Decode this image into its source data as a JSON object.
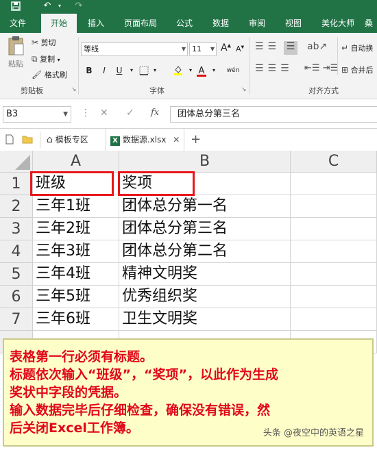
{
  "qat": {
    "save_icon": "save-icon",
    "undo_icon": "undo-icon",
    "redo_icon": "redo-icon"
  },
  "tabs": [
    {
      "label": "文件"
    },
    {
      "label": "开始"
    },
    {
      "label": "插入"
    },
    {
      "label": "页面布局"
    },
    {
      "label": "公式"
    },
    {
      "label": "数据"
    },
    {
      "label": "审阅"
    },
    {
      "label": "视图"
    },
    {
      "label": "美化大师"
    },
    {
      "label": "桑"
    }
  ],
  "ribbon": {
    "clipboard": {
      "paste": "粘贴",
      "cut": "剪切",
      "copy": "复制",
      "format_painter": "格式刷",
      "label": "剪贴板"
    },
    "font": {
      "family": "等线",
      "size": "11",
      "grow": "A",
      "shrink": "A",
      "label": "字体",
      "bold": "B",
      "italic": "I",
      "underline": "U",
      "wen": "wén"
    },
    "alignment": {
      "wrap": "自动换",
      "merge": "合并后",
      "label": "对齐方式"
    }
  },
  "formula_bar": {
    "name_box": "B3",
    "fx": "fx",
    "cancel": "✕",
    "confirm": "✓",
    "content": "团体总分第三名"
  },
  "file_tabs": {
    "template_tab": "模板专区",
    "file_tab": "数据源.xlsx",
    "close": "✕",
    "add": "+"
  },
  "sheet": {
    "columns": [
      "A",
      "B",
      "C"
    ],
    "rows": [
      {
        "num": "1",
        "a": "班级",
        "b": "奖项"
      },
      {
        "num": "2",
        "a": "三年1班",
        "b": "团体总分第一名"
      },
      {
        "num": "3",
        "a": "三年2班",
        "b": "团体总分第三名"
      },
      {
        "num": "4",
        "a": "三年3班",
        "b": "团体总分第二名"
      },
      {
        "num": "5",
        "a": "三年4班",
        "b": "精神文明奖"
      },
      {
        "num": "6",
        "a": "三年5班",
        "b": "优秀组织奖"
      },
      {
        "num": "7",
        "a": "三年6班",
        "b": "卫生文明奖"
      }
    ]
  },
  "note": {
    "lines": [
      "表格第一行必须有标题。",
      "标题依次输入“班级”，“奖项”，以此作为生成",
      "奖状中字段的凭据。",
      "输入数据完毕后仔细检查，确保没有错误，然",
      "后关闭Excel工作簿。"
    ]
  },
  "watermark": "头条 @夜空中的英语之星",
  "colors": {
    "excel_green": "#217346",
    "annotation_red": "#e0081a",
    "note_bg": "#fefec9"
  }
}
